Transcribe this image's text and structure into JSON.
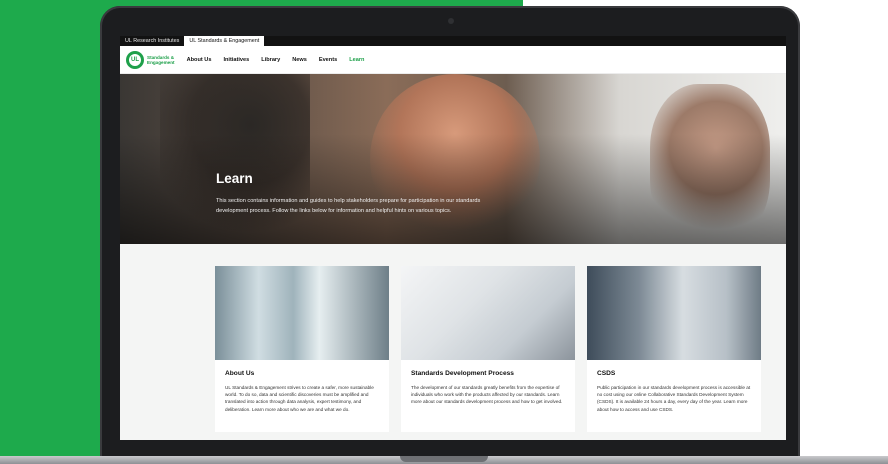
{
  "top_tabs": [
    {
      "label": "UL Research Institutes"
    },
    {
      "label": "UL Standards & Engagement"
    }
  ],
  "logo": {
    "mark": "UL",
    "line1": "Standards &",
    "line2": "Engagement"
  },
  "nav": [
    {
      "label": "About Us"
    },
    {
      "label": "Initiatives"
    },
    {
      "label": "Library"
    },
    {
      "label": "News"
    },
    {
      "label": "Events"
    },
    {
      "label": "Learn"
    }
  ],
  "hero": {
    "title": "Learn",
    "description": "This section contains information and guides to help stakeholders prepare for participation in our standards development process. Follow the links below for information and helpful hints on various topics."
  },
  "cards": [
    {
      "title": "About Us",
      "text": "UL Standards & Engagement strives to create a safer, more sustainable world. To do so, data and scientific discoveries must be amplified and translated into action through data analysis, expert testimony, and deliberation. Learn more about who we are and what we do."
    },
    {
      "title": "Standards Development Process",
      "text": "The development of our standards greatly benefits from the expertise of individuals who work with the products affected by our standards. Learn more about our standards development process and how to get involved."
    },
    {
      "title": "CSDS",
      "text": "Public participation in our standards development process is accessible at no cost using our online Collaborative Standards Development System (CSDS). It is available 24 hours a day, every day of the year. Learn more about how to access and use CSDS."
    }
  ],
  "colors": {
    "brand_green": "#1ea04a",
    "background_green": "#1eaa4c"
  }
}
